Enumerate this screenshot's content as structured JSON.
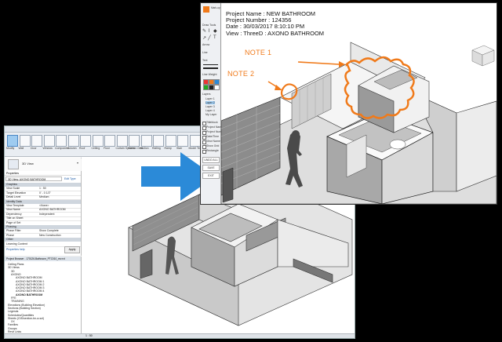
{
  "revit": {
    "ribbon_buttons": [
      "Modify",
      "Wall",
      "Door",
      "Window",
      "Component",
      "Column",
      "Roof",
      "Ceiling",
      "Floor",
      "Curtain System",
      "Curtain Grid",
      "Mullion",
      "Railing",
      "Ramp",
      "Stair",
      "Model Text",
      "Model Line",
      "Model Group"
    ],
    "type_selector": "3D View",
    "properties_title": "Properties",
    "view_dropdown": "3D View: AXONO BATHROOM",
    "edit_type": "Edit Type",
    "properties_rows": [
      {
        "k": "Graphics",
        "v": "",
        "header": true
      },
      {
        "k": "View Scale",
        "v": "1 : 50"
      },
      {
        "k": "Target Elevation",
        "v": "0' - 0 1/2\""
      },
      {
        "k": "Detail Level",
        "v": "Medium"
      },
      {
        "k": "Identity Data",
        "v": "",
        "header": true
      },
      {
        "k": "View Template",
        "v": "<None>"
      },
      {
        "k": "View Name",
        "v": "AXONO BATHROOM"
      },
      {
        "k": "Dependency",
        "v": "Independent"
      },
      {
        "k": "Title on Sheet",
        "v": ""
      },
      {
        "k": "Page of Set",
        "v": ""
      },
      {
        "k": "Phasing",
        "v": "",
        "header": true
      },
      {
        "k": "Phase Filter",
        "v": "Show Complete"
      },
      {
        "k": "Phase",
        "v": "New Construction"
      },
      {
        "k": "Other",
        "v": "",
        "header": true
      },
      {
        "k": "Learning Content",
        "v": ""
      }
    ],
    "properties_help": "Properties help",
    "apply": "Apply",
    "browser_title": "Project Browser - 170126-Bathroom_PTC010_rev.rvt",
    "browser_items": [
      "Ceiling Plans",
      "3D Views",
      "3D",
      "AXONO",
      "AXONO BATHROOM",
      "AXONO BATHROOM 1",
      "AXONO BATHROOM 2",
      "AXONO BATHROOM 3",
      "AXONO BATHROOM 4",
      "AXONO BATHROOM",
      "FFE",
      "TRAINING",
      "Elevations (Building Elevation)",
      "Sections (Building Section)",
      "Legends",
      "Schedules/Quantities",
      "Sheets (GIS/section-bn-a-sol)",
      "XX",
      "Families",
      "Groups",
      "Revit Links"
    ],
    "status_scale": "1 : 50"
  },
  "markup": {
    "tools": {
      "header": "Mark-up",
      "draw_tools_label": "Draw Tools",
      "arrow_label": "Arrow",
      "line_label": "Line",
      "text_label": "Text",
      "weight_label": "Line Weight",
      "layers_label": "Layers",
      "layer_items": [
        "Layer 1",
        "Layer 2",
        "Layer 3",
        "Layer 4",
        "My Layer"
      ],
      "checks": [
        "Titleblock",
        "Project Name",
        "Project Number",
        "Date/Time",
        "View Name",
        "Show Grid",
        "Rectangle"
      ],
      "buttons": [
        "UNDO ALL",
        "SAVE",
        "EXIT"
      ]
    },
    "info": {
      "project_name": "Project Name : NEW BATHROOM",
      "project_number": "Project Number : 124356",
      "date": "Date : 30/03/2017 8:10:10 PM",
      "view": "View : ThreeD : AXONO BATHROOM"
    },
    "note1": "NOTE 1",
    "note2": "NOTE 2"
  },
  "colors": {
    "note": "#f07a1a",
    "arrow": "#2b8ad8",
    "highlight": "#9ecbf0"
  }
}
